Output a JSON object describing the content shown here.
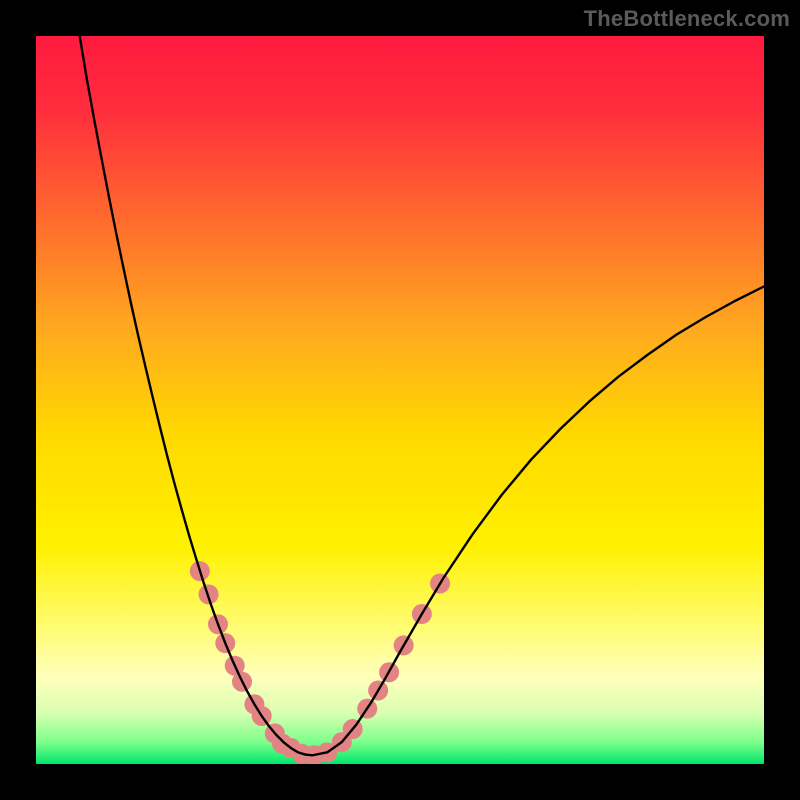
{
  "watermark": "TheBottleneck.com",
  "chart_data": {
    "type": "line",
    "title": "",
    "xlabel": "",
    "ylabel": "",
    "xlim": [
      0,
      100
    ],
    "ylim": [
      0,
      100
    ],
    "grid": false,
    "legend": false,
    "gradient_stops": [
      {
        "offset": 0.0,
        "color": "#ff1a3f"
      },
      {
        "offset": 0.1,
        "color": "#ff2d3d"
      },
      {
        "offset": 0.25,
        "color": "#ff6a2e"
      },
      {
        "offset": 0.4,
        "color": "#ffa81f"
      },
      {
        "offset": 0.55,
        "color": "#ffd900"
      },
      {
        "offset": 0.7,
        "color": "#fff100"
      },
      {
        "offset": 0.8,
        "color": "#fffb66"
      },
      {
        "offset": 0.88,
        "color": "#ffffbb"
      },
      {
        "offset": 0.93,
        "color": "#d9ffb0"
      },
      {
        "offset": 0.97,
        "color": "#7dff8c"
      },
      {
        "offset": 1.0,
        "color": "#00e66b"
      }
    ],
    "series": [
      {
        "name": "bottleneck-curve",
        "color": "#000000",
        "stroke_width": 2.4,
        "x": [
          6,
          7,
          8,
          9,
          10,
          11,
          12,
          13,
          14,
          15,
          16,
          17,
          18,
          19,
          20,
          21,
          22,
          23,
          24,
          25,
          26,
          27,
          28,
          29,
          30,
          31,
          32,
          33,
          34,
          35,
          36,
          37,
          38,
          40,
          42,
          44,
          46,
          48,
          50,
          53,
          56,
          60,
          64,
          68,
          72,
          76,
          80,
          84,
          88,
          92,
          96,
          100
        ],
        "y": [
          100,
          94,
          88.5,
          83.2,
          78,
          73,
          68.2,
          63.5,
          59,
          54.7,
          50.5,
          46.4,
          42.4,
          38.6,
          35,
          31.5,
          28.2,
          25,
          22,
          19.2,
          16.6,
          14.2,
          12,
          10,
          8.2,
          6.6,
          5.2,
          4,
          3,
          2.2,
          1.6,
          1.3,
          1.2,
          1.6,
          3,
          5.4,
          8.4,
          11.8,
          15.4,
          20.6,
          25.6,
          31.6,
          37,
          41.8,
          46,
          49.8,
          53.2,
          56.2,
          59,
          61.4,
          63.6,
          65.6
        ]
      }
    ],
    "bead_markers": {
      "color": "#e38383",
      "radius_px": 10,
      "points": [
        {
          "x": 22.5,
          "y": 26.5
        },
        {
          "x": 23.7,
          "y": 23.3
        },
        {
          "x": 25.0,
          "y": 19.2
        },
        {
          "x": 26.0,
          "y": 16.6
        },
        {
          "x": 27.3,
          "y": 13.5
        },
        {
          "x": 28.3,
          "y": 11.3
        },
        {
          "x": 30.0,
          "y": 8.2
        },
        {
          "x": 31.0,
          "y": 6.6
        },
        {
          "x": 32.8,
          "y": 4.2
        },
        {
          "x": 33.8,
          "y": 2.8
        },
        {
          "x": 35.0,
          "y": 2.2
        },
        {
          "x": 36.5,
          "y": 1.4
        },
        {
          "x": 38.2,
          "y": 1.2
        },
        {
          "x": 40.0,
          "y": 1.6
        },
        {
          "x": 42.0,
          "y": 3.0
        },
        {
          "x": 43.5,
          "y": 4.8
        },
        {
          "x": 45.5,
          "y": 7.6
        },
        {
          "x": 47.0,
          "y": 10.1
        },
        {
          "x": 48.5,
          "y": 12.6
        },
        {
          "x": 50.5,
          "y": 16.3
        },
        {
          "x": 53.0,
          "y": 20.6
        },
        {
          "x": 55.5,
          "y": 24.8
        }
      ]
    }
  }
}
